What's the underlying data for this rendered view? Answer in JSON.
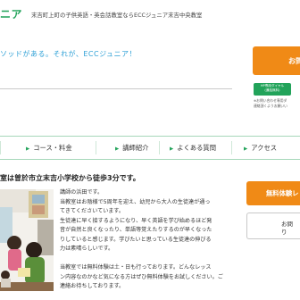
{
  "header": {
    "logo_text": "ニア",
    "tagline": "末吉町上町の子供英語・英会話教室ならECCジュニア末吉中央教室"
  },
  "hero": {
    "catch_copy": "ソッドがある。それが、ECCジュニア！",
    "cta_label": "お問"
  },
  "tel": {
    "badge_line1": "HP専用ダイヤル",
    "badge_line2": "(通話無料)",
    "note_line1": "※お問い合わせ専用ダ",
    "note_line2": "連絡頂くようお願いい"
  },
  "nav": {
    "items": [
      {
        "label": "コース・料金"
      },
      {
        "label": "講師紹介"
      },
      {
        "label": "よくある質問"
      },
      {
        "label": "アクセス"
      }
    ]
  },
  "school": {
    "title": "室は曽於市立末吉小学校から徒歩3分です。"
  },
  "body": {
    "lines": [
      "講師の浜田です。",
      "当教室はお陰様で5周年を迎え、幼児から大人の生徒達が通っ",
      "てきてくださいています。",
      "生徒達に早く接するようになり、早く英語を学び始めるほど発",
      "音が自然と良くなったり、単語等覚えたりするのが早くなった",
      "りしていると感じます。学びたいと思っている生徒達の伸びる",
      "力は素晴らしいです。",
      "",
      "当教室では無料体験は土・日も行っております。どんなレッス",
      "ン内容なのかなど気になる方はぜひ無料体験をお試しください。ご",
      "連絡お待ちしております。"
    ]
  },
  "sidebar": {
    "trial_label": "無料体験レ",
    "contact_line1": "お問",
    "contact_line2": "り"
  },
  "colors": {
    "brand_green": "#22a35a",
    "accent_orange": "#f08a16",
    "catch_blue": "#2ea0d6"
  }
}
